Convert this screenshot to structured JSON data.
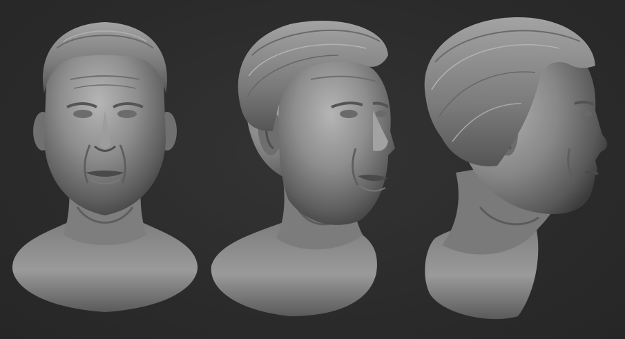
{
  "scene": {
    "background_color": "#2c2c2c",
    "material_color": "#8a8a8a",
    "views": [
      {
        "angle": "front"
      },
      {
        "angle": "three-quarter"
      },
      {
        "angle": "profile"
      }
    ]
  }
}
